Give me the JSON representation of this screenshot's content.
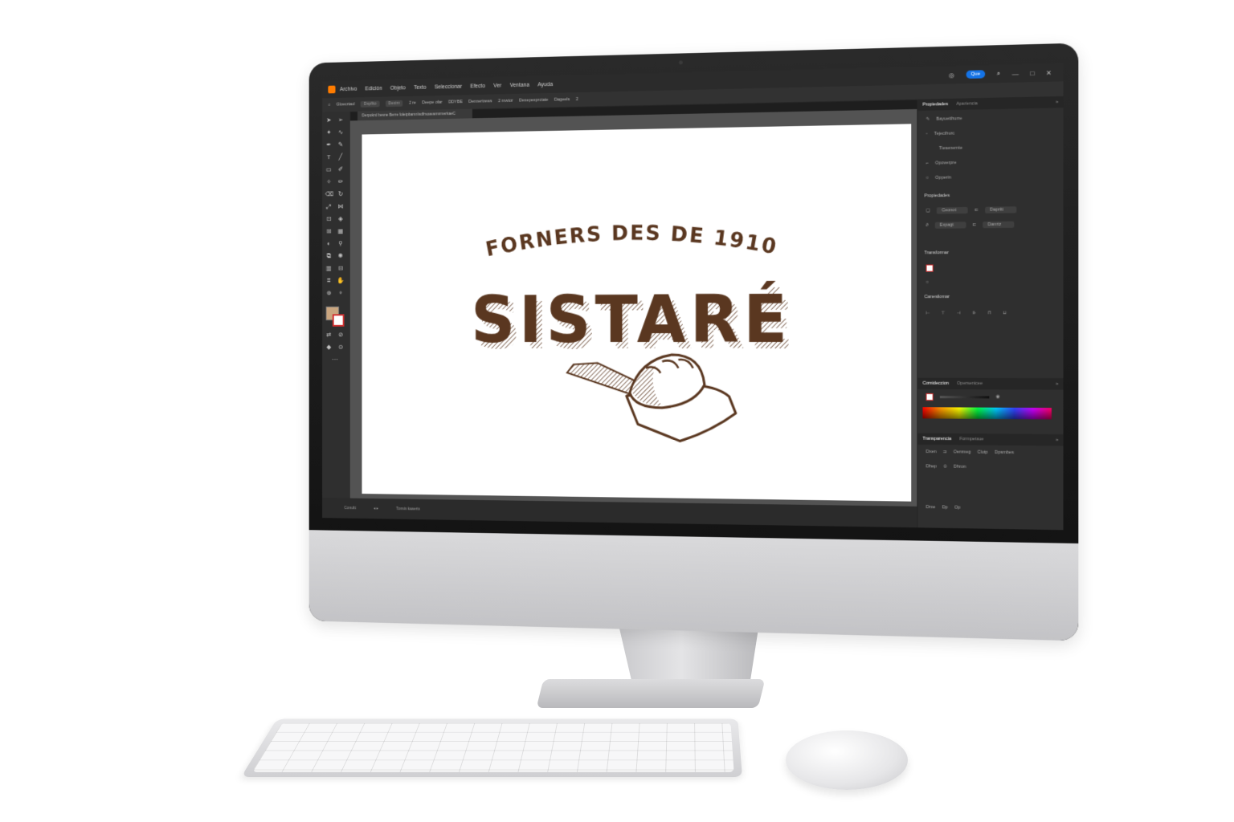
{
  "app": {
    "share_label": "Que",
    "menu": [
      "Archivo",
      "Edición",
      "Objeto",
      "Texto",
      "Seleccionar",
      "Efecto",
      "Ver",
      "Ventana",
      "Ayuda"
    ],
    "document_tab": "Derpokrd besne Berre foletpbamr/wdfrsoavamnmerkaeC",
    "colors": {
      "accent": "#1473e6",
      "brand_brown": "#5a3720",
      "fill_swatch": "#c9a57f",
      "logo_orange": "#ff7c00"
    }
  },
  "controlbar": {
    "items": [
      "Gloecrtaul",
      "Dxpfito",
      "Dexirn",
      "2 re",
      "Deepe ofar",
      "DDYBE",
      "Dennertrews",
      "2 mwtor",
      "Dexepexprctaie",
      "Dageels",
      "2"
    ]
  },
  "panels": {
    "top_tabs": [
      "Propiedades",
      "Apariencia"
    ],
    "rows": [
      "Bayuetthurre",
      "Tejecthurc",
      "Tiesenemte",
      "Opoverpre",
      "Opperin"
    ],
    "section_properties": "Propiedades",
    "field_rows": [
      {
        "a": "Ceonot",
        "b": "Dapritt"
      },
      {
        "a": "Expagt",
        "b": "Danrtz"
      }
    ],
    "section_transform": "Transformar",
    "section_align": "Canesilomar",
    "color_tabs": [
      "Comideccion",
      "Opersenicee"
    ],
    "transparency_tabs": [
      "Transparencia",
      "Formpetsue"
    ],
    "transparency_rows": [
      {
        "label": "Dxen",
        "a": "Oenmeg",
        "b": "Clutp",
        "c": "Dpsmbes"
      },
      {
        "label": "Dhep",
        "a": "Dhron",
        "b": "",
        "c": ""
      }
    ],
    "bottom_row": [
      "Dme",
      "Dp",
      "Op"
    ]
  },
  "status": {
    "zoom_label": "Conultt",
    "center_label": "Tonsis kaaerts"
  },
  "artwork": {
    "tagline": "FORNERS DES DE 1910",
    "brand": "SISTARÉ"
  }
}
